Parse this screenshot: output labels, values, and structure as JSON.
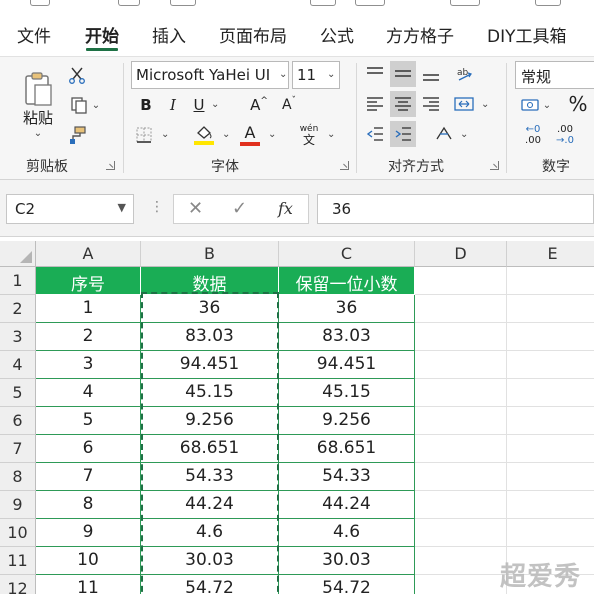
{
  "ribbon_tabs": [
    {
      "label": "文件"
    },
    {
      "label": "开始"
    },
    {
      "label": "插入"
    },
    {
      "label": "页面布局"
    },
    {
      "label": "公式"
    },
    {
      "label": "方方格子"
    },
    {
      "label": "DIY工具箱"
    }
  ],
  "active_tab": "开始",
  "clipboard": {
    "paste_label": "粘贴",
    "group_label": "剪贴板"
  },
  "font": {
    "name": "Microsoft YaHei UI",
    "size": "11",
    "bold": "B",
    "italic": "I",
    "underline": "U",
    "grow": "A",
    "shrink": "A",
    "font_color": "A",
    "phonetic_top": "wén",
    "phonetic_char": "文",
    "group_label": "字体"
  },
  "alignment": {
    "group_label": "对齐方式"
  },
  "number": {
    "format": "常规",
    "percent": "%",
    "inc_decimal_top": "←0",
    "inc_decimal_bottom": ".00",
    "dec_decimal_top": ".00",
    "dec_decimal_bottom": "→.0",
    "group_label": "数字"
  },
  "formula_bar": {
    "name_box": "C2",
    "fx_label": "fx",
    "formula": "36"
  },
  "columns": [
    "A",
    "B",
    "C",
    "D",
    "E"
  ],
  "rows": [
    "1",
    "2",
    "3",
    "4",
    "5",
    "6",
    "7",
    "8",
    "9",
    "10",
    "11",
    "12"
  ],
  "table": {
    "headers": [
      "序号",
      "数据",
      "保留一位小数"
    ],
    "rows": [
      [
        "1",
        "36",
        "36"
      ],
      [
        "2",
        "83.03",
        "83.03"
      ],
      [
        "3",
        "94.451",
        "94.451"
      ],
      [
        "4",
        "45.15",
        "45.15"
      ],
      [
        "5",
        "9.256",
        "9.256"
      ],
      [
        "6",
        "68.651",
        "68.651"
      ],
      [
        "7",
        "54.33",
        "54.33"
      ],
      [
        "8",
        "44.24",
        "44.24"
      ],
      [
        "9",
        "4.6",
        "4.6"
      ],
      [
        "10",
        "30.03",
        "30.03"
      ],
      [
        "11",
        "54.72",
        "54.72"
      ]
    ]
  },
  "colors": {
    "header_green": "#1aad55",
    "accent_green": "#1e7145",
    "font_color_red": "#e0301e",
    "fill_yellow": "#ffe600"
  },
  "watermark": "超爱秀"
}
